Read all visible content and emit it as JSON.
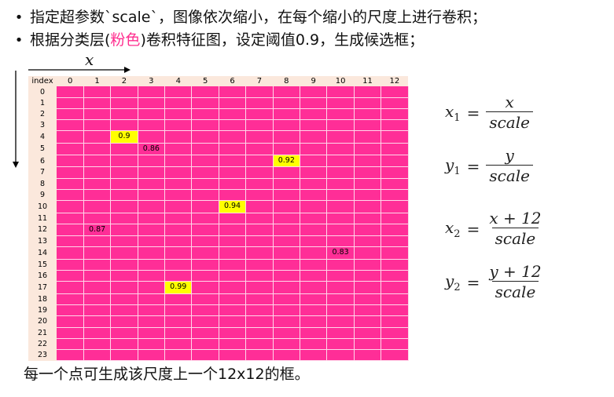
{
  "bullets": [
    {
      "prefix": "指定超参数`scale`，图像依次缩小，在每个缩小的尺度上进行卷积；",
      "highlight": "",
      "suffix": ""
    },
    {
      "prefix": "根据分类层(",
      "highlight": "粉色",
      "suffix": ")卷积特征图，设定阈值0.9，生成候选框；"
    }
  ],
  "axis": {
    "x_label": "x"
  },
  "grid": {
    "index_header": "index",
    "columns": [
      "0",
      "1",
      "2",
      "3",
      "4",
      "5",
      "6",
      "7",
      "8",
      "9",
      "10",
      "11",
      "12"
    ],
    "rows": [
      "0",
      "1",
      "2",
      "3",
      "4",
      "5",
      "6",
      "7",
      "8",
      "9",
      "10",
      "11",
      "12",
      "13",
      "14",
      "15",
      "16",
      "17",
      "18",
      "19",
      "20",
      "21",
      "22",
      "23"
    ],
    "cell_color": "#ff2e97",
    "highlight_color": "#ffff00",
    "values": [
      {
        "row": 4,
        "col": 2,
        "text": "0.9",
        "highlight": true
      },
      {
        "row": 5,
        "col": 3,
        "text": "0.86",
        "highlight": false
      },
      {
        "row": 6,
        "col": 8,
        "text": "0.92",
        "highlight": true
      },
      {
        "row": 10,
        "col": 6,
        "text": "0.94",
        "highlight": true
      },
      {
        "row": 12,
        "col": 1,
        "text": "0.87",
        "highlight": false
      },
      {
        "row": 14,
        "col": 10,
        "text": "0.83",
        "highlight": false
      },
      {
        "row": 17,
        "col": 4,
        "text": "0.99",
        "highlight": true
      }
    ]
  },
  "formulas": [
    {
      "var": "x",
      "sub": "1",
      "num": "x",
      "den": "scale"
    },
    {
      "var": "y",
      "sub": "1",
      "num": "y",
      "den": "scale"
    },
    {
      "var": "x",
      "sub": "2",
      "num": "x + 12",
      "den": "scale"
    },
    {
      "var": "y",
      "sub": "2",
      "num": "y + 12",
      "den": "scale"
    }
  ],
  "footer": "每一个点可生成该尺度上一个12x12的框。"
}
